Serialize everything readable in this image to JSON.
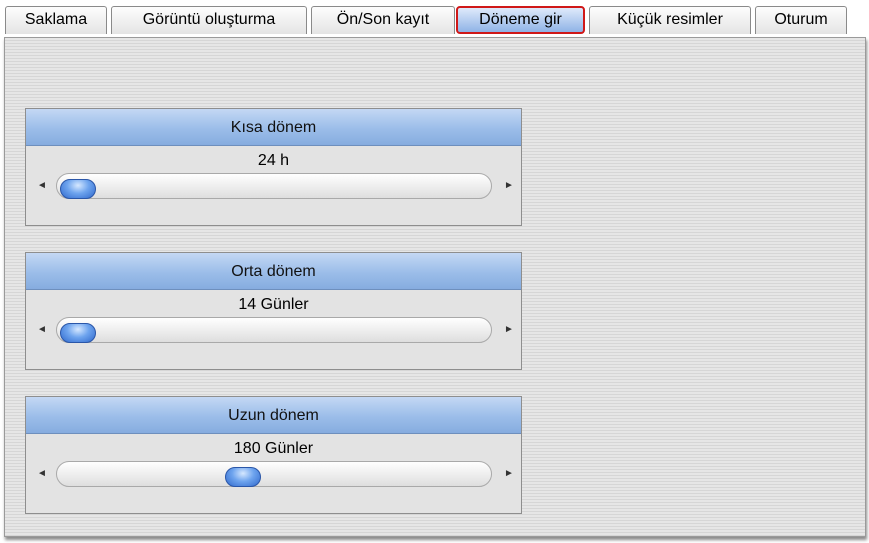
{
  "tabs": [
    {
      "label": "Saklama",
      "active": false
    },
    {
      "label": "Görüntü oluşturma",
      "active": false
    },
    {
      "label": "Ön/Son kayıt",
      "active": false
    },
    {
      "label": "Döneme gir",
      "active": true
    },
    {
      "label": "Küçük resimler",
      "active": false
    },
    {
      "label": "Oturum",
      "active": false
    }
  ],
  "colors": {
    "active_tab_border": "#d01818",
    "header_blue": "#9bbde9",
    "thumb_blue": "#2f68cc"
  },
  "periods": [
    {
      "title": "Kısa dönem",
      "value_label": "24 h",
      "slider_level": 0.0
    },
    {
      "title": "Orta dönem",
      "value_label": "14 Günler",
      "slider_level": 0.0
    },
    {
      "title": "Uzun dönem",
      "value_label": "180 Günler",
      "slider_level": 0.42
    }
  ],
  "icons": {
    "left_arrow": "◄",
    "right_arrow": "►"
  }
}
